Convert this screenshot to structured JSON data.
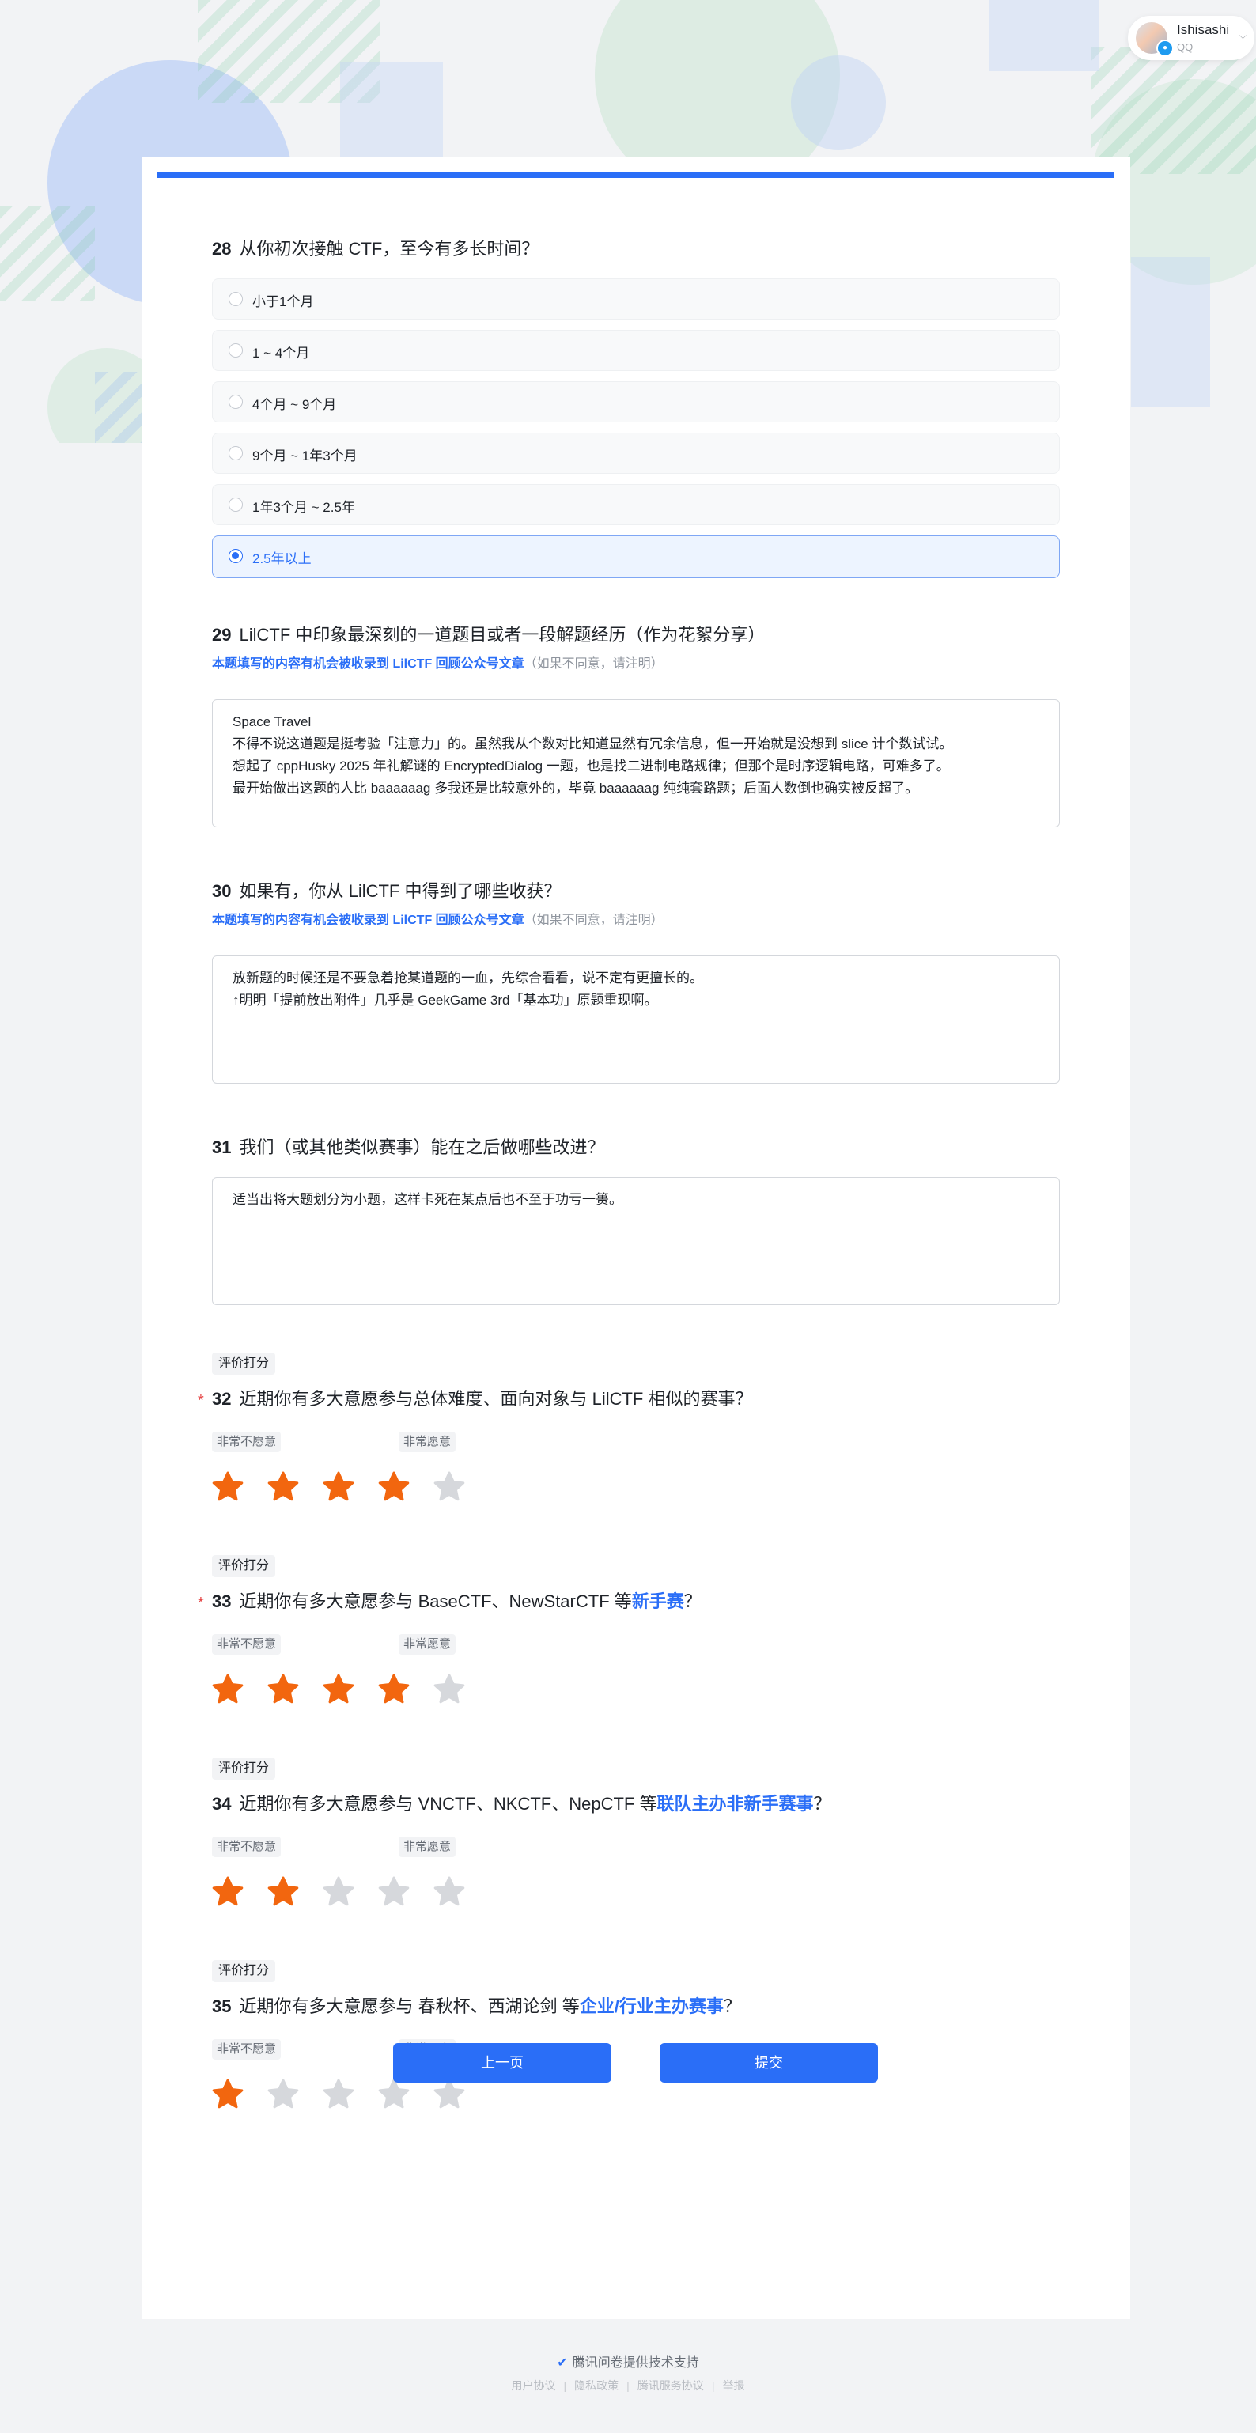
{
  "user": {
    "name": "Ishisashi",
    "platform": "QQ"
  },
  "q28": {
    "num": "28",
    "title": "从你初次接触 CTF，至今有多长时间？",
    "options": [
      "小于1个月",
      "1 ~ 4个月",
      "4个月 ~ 9个月",
      "9个月 ~ 1年3个月",
      "1年3个月 ~ 2.5年",
      "2.5年以上"
    ],
    "selected_index": 5
  },
  "q29": {
    "num": "29",
    "title": "LilCTF 中印象最深刻的一道题目或者一段解题经历（作为花絮分享）",
    "note_blue": "本题填写的内容有机会被收录到 LilCTF 回顾公众号文章",
    "note_gray": "（如果不同意，请注明）",
    "answer": "Space Travel\n不得不说这道题是挺考验「注意力」的。虽然我从个数对比知道显然有冗余信息，但一开始就是没想到 slice 计个数试试。\n想起了 cppHusky 2025 年礼解谜的 EncryptedDialog 一题，也是找二进制电路规律；但那个是时序逻辑电路，可难多了。\n最开始做出这题的人比 baaaaaag 多我还是比较意外的，毕竟 baaaaaag 纯纯套路题；后面人数倒也确实被反超了。"
  },
  "q30": {
    "num": "30",
    "title": "如果有，你从 LilCTF 中得到了哪些收获？",
    "note_blue": "本题填写的内容有机会被收录到 LilCTF 回顾公众号文章",
    "note_gray": "（如果不同意，请注明）",
    "answer": "放新题的时候还是不要急着抢某道题的一血，先综合看看，说不定有更擅长的。\n↑明明「提前放出附件」几乎是 GeekGame 3rd「基本功」原题重现啊。"
  },
  "q31": {
    "num": "31",
    "title": "我们（或其他类似赛事）能在之后做哪些改进？",
    "answer": "适当出将大题划分为小题，这样卡死在某点后也不至于功亏一篑。"
  },
  "rating_tag": "评价打分",
  "scale": {
    "low": "非常不愿意",
    "high": "非常愿意"
  },
  "q32": {
    "num": "32",
    "required": true,
    "title": "近期你有多大意愿参与总体难度、面向对象与 LilCTF 相似的赛事？",
    "rating": 4,
    "max": 5
  },
  "q33": {
    "num": "33",
    "required": true,
    "title_pre": "近期你有多大意愿参与 BaseCTF、NewStarCTF 等",
    "title_hl": "新手赛",
    "title_post": "？",
    "rating": 4,
    "max": 5
  },
  "q34": {
    "num": "34",
    "required": false,
    "title_pre": "近期你有多大意愿参与 VNCTF、NKCTF、NepCTF 等",
    "title_hl": "联队主办非新手赛事",
    "title_post": "？",
    "rating": 2,
    "max": 5
  },
  "q35": {
    "num": "35",
    "required": false,
    "title_pre": "近期你有多大意愿参与 春秋杯、西湖论剑 等",
    "title_hl": "企业/行业主办赛事",
    "title_post": "？",
    "rating": 1,
    "max": 5
  },
  "buttons": {
    "prev": "上一页",
    "submit": "提交"
  },
  "footer": {
    "brand": "腾讯问卷提供技术支持",
    "links": [
      "用户协议",
      "隐私政策",
      "腾讯服务协议",
      "举报"
    ]
  },
  "colors": {
    "accent": "#2a6ef7",
    "star_on": "#f2660f",
    "star_off": "#d6d8dc",
    "required": "#e54545"
  }
}
